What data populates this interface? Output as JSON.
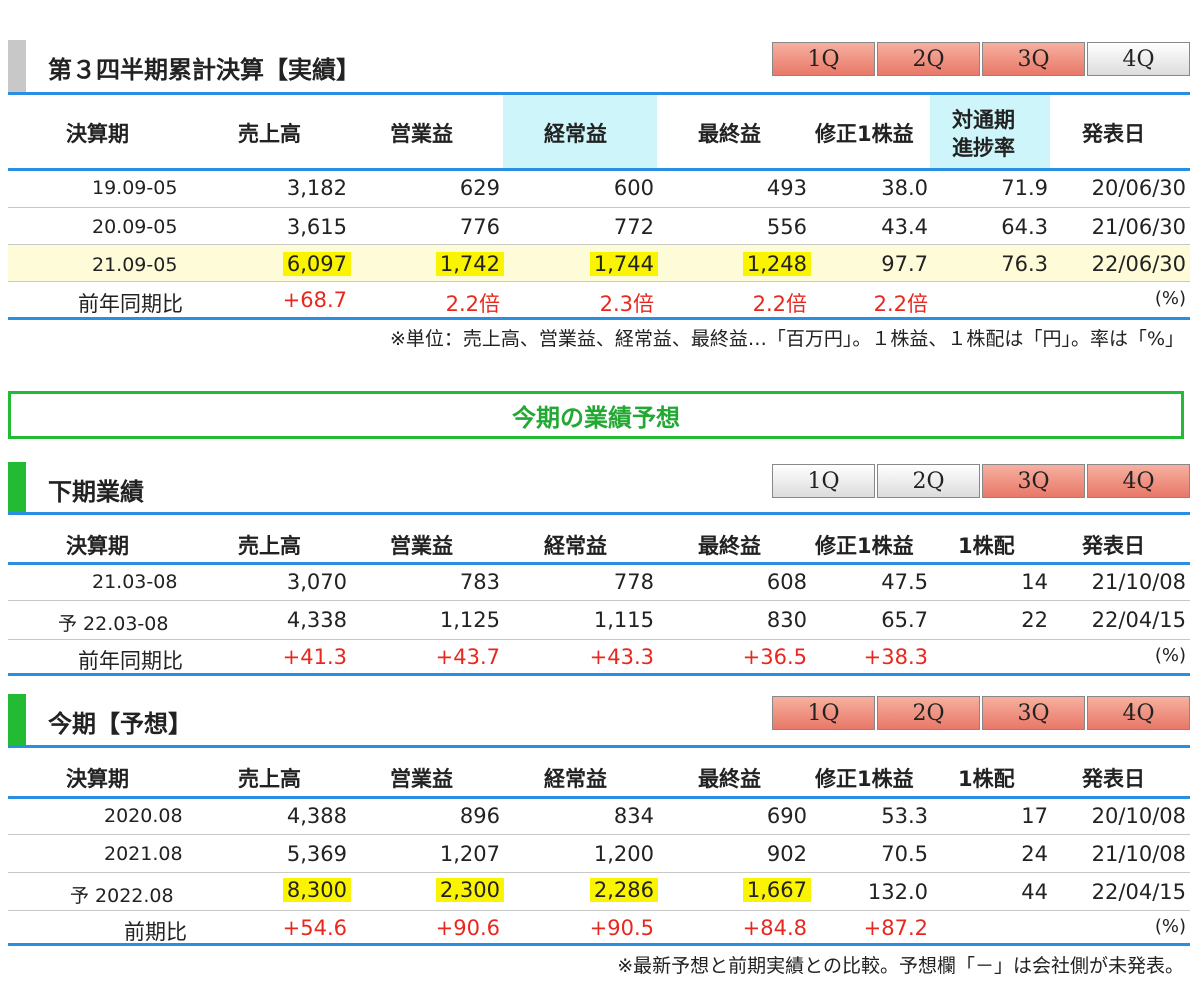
{
  "section1": {
    "title": "第３四半期累計決算【実績】",
    "tabs": [
      "1Q",
      "2Q",
      "3Q",
      "4Q"
    ],
    "headers": [
      "決算期",
      "売上高",
      "営業益",
      "経常益",
      "最終益",
      "修正1株益",
      "対通期",
      "進捗率",
      "発表日"
    ],
    "rows": [
      [
        "19.09-05",
        "3,182",
        "629",
        "600",
        "493",
        "38.0",
        "71.9",
        "20/06/30"
      ],
      [
        "20.09-05",
        "3,615",
        "776",
        "772",
        "556",
        "43.4",
        "64.3",
        "21/06/30"
      ],
      [
        "21.09-05",
        "6,097",
        "1,742",
        "1,744",
        "1,248",
        "97.7",
        "76.3",
        "22/06/30"
      ]
    ],
    "yoy": [
      "前年同期比",
      "+68.7",
      "2.2倍",
      "2.3倍",
      "2.2倍",
      "2.2倍",
      "(%)"
    ],
    "note": "※単位：売上高、営業益、経常益、最終益…「百万円」。１株益、１株配は「円」。率は「%」"
  },
  "banner": "今期の業績予想",
  "section2": {
    "title": "下期業績",
    "tabs": [
      "1Q",
      "2Q",
      "3Q",
      "4Q"
    ],
    "headers": [
      "決算期",
      "売上高",
      "営業益",
      "経常益",
      "最終益",
      "修正1株益",
      "1株配",
      "発表日"
    ],
    "rows": [
      [
        "21.03-08",
        "3,070",
        "783",
        "778",
        "608",
        "47.5",
        "14",
        "21/10/08"
      ],
      [
        "予 22.03-08",
        "4,338",
        "1,125",
        "1,115",
        "830",
        "65.7",
        "22",
        "22/04/15"
      ]
    ],
    "yoy": [
      "前年同期比",
      "+41.3",
      "+43.7",
      "+43.3",
      "+36.5",
      "+38.3",
      "(%)"
    ]
  },
  "section3": {
    "title": "今期【予想】",
    "tabs": [
      "1Q",
      "2Q",
      "3Q",
      "4Q"
    ],
    "headers": [
      "決算期",
      "売上高",
      "営業益",
      "経常益",
      "最終益",
      "修正1株益",
      "1株配",
      "発表日"
    ],
    "rows": [
      [
        "2020.08",
        "4,388",
        "896",
        "834",
        "690",
        "53.3",
        "17",
        "20/10/08"
      ],
      [
        "2021.08",
        "5,369",
        "1,207",
        "1,200",
        "902",
        "70.5",
        "24",
        "21/10/08"
      ],
      [
        "予 2022.08",
        "8,300",
        "2,300",
        "2,286",
        "1,667",
        "132.0",
        "44",
        "22/04/15"
      ]
    ],
    "yoy": [
      "前期比",
      "+54.6",
      "+90.6",
      "+90.5",
      "+84.8",
      "+87.2",
      "(%)"
    ],
    "note": "※最新予想と前期実績との比較。予想欄「－」は会社側が未発表。"
  },
  "colors": {
    "accent_blue": "#2a8fe0",
    "green": "#22bb33",
    "red": "#e8281e",
    "highlight": "#fbf400"
  }
}
